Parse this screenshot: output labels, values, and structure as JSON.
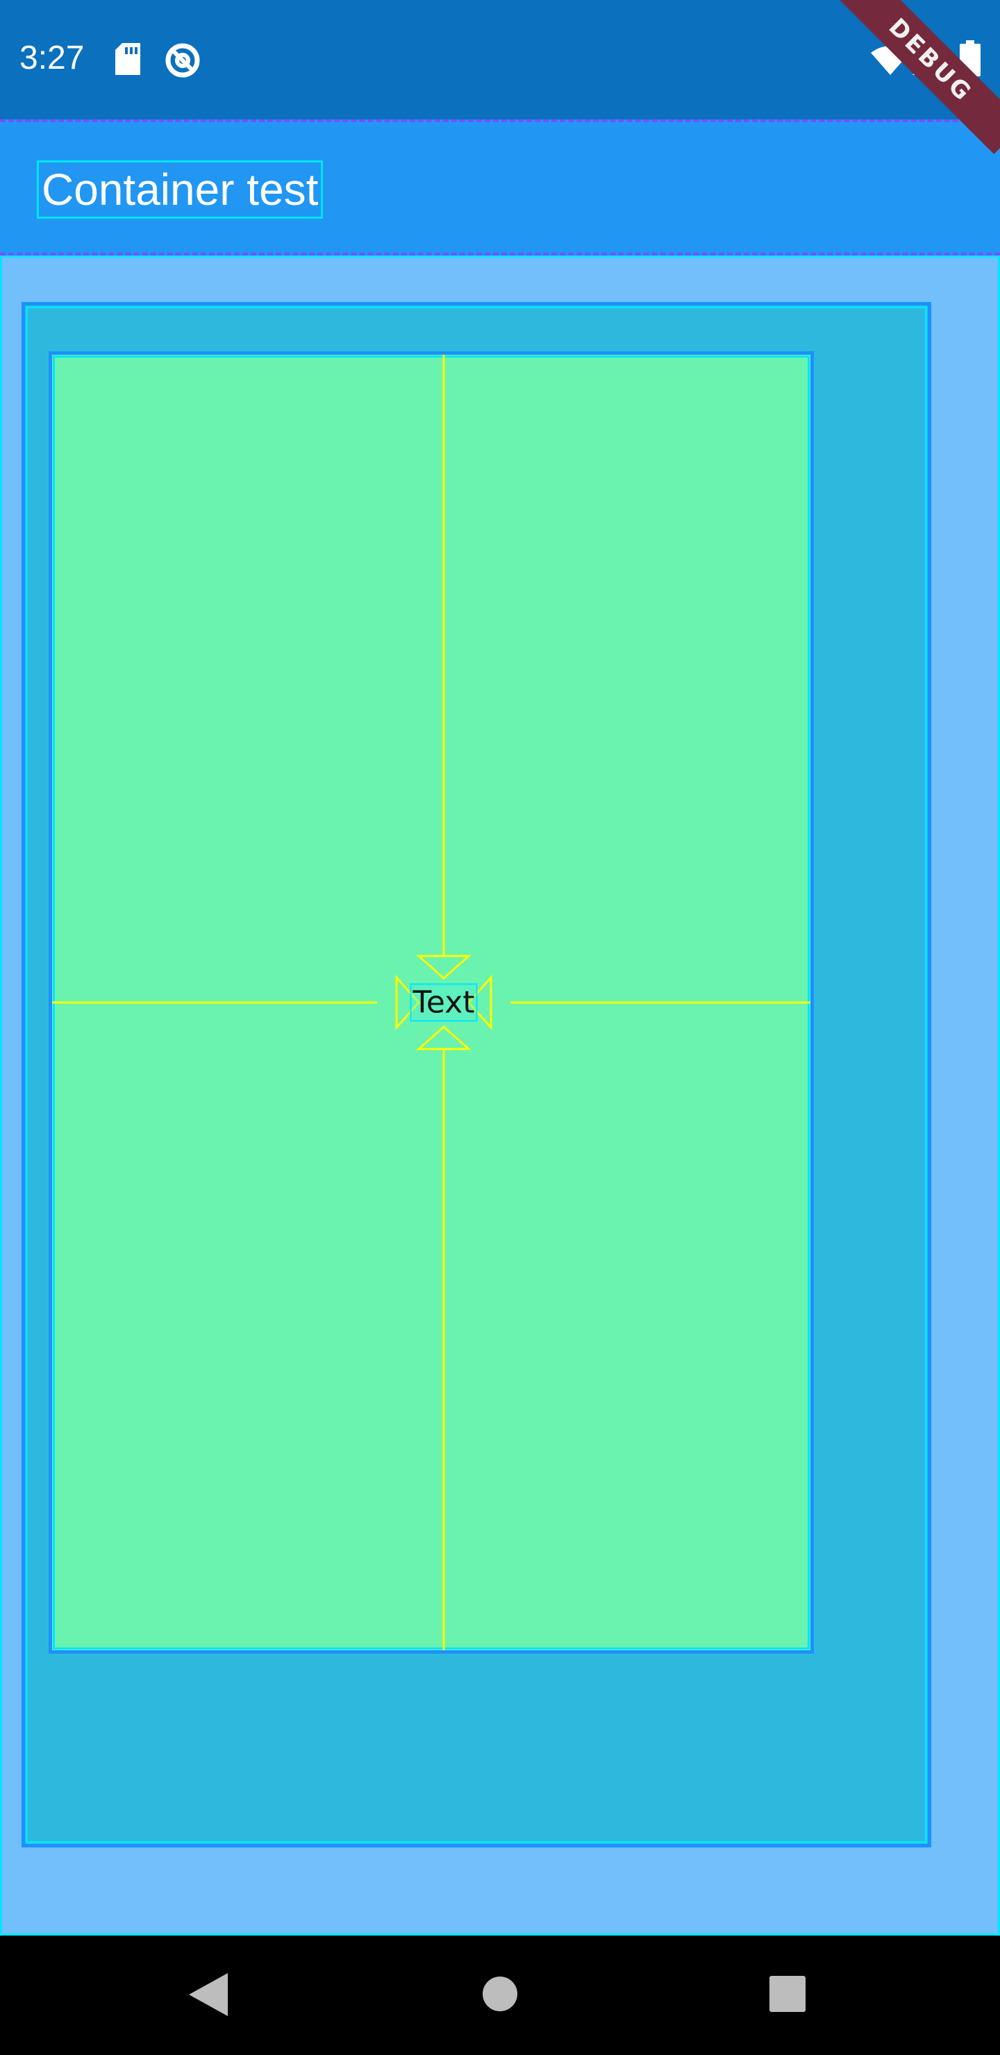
{
  "status_bar": {
    "time": "3:27",
    "icons": [
      "sd-card-icon",
      "sync-icon",
      "wifi-icon",
      "signal-icon",
      "battery-icon"
    ]
  },
  "debug_banner": {
    "label": "DEBUG"
  },
  "app_bar": {
    "title": "Container test",
    "color": "#2196f3"
  },
  "content": {
    "center_text": "Text",
    "outer_color": "#2fb8dd",
    "inner_color": "#6af2af",
    "background_color": "#72bffc"
  },
  "nav_bar": {
    "buttons": [
      "back-icon",
      "home-icon",
      "recents-icon"
    ]
  }
}
